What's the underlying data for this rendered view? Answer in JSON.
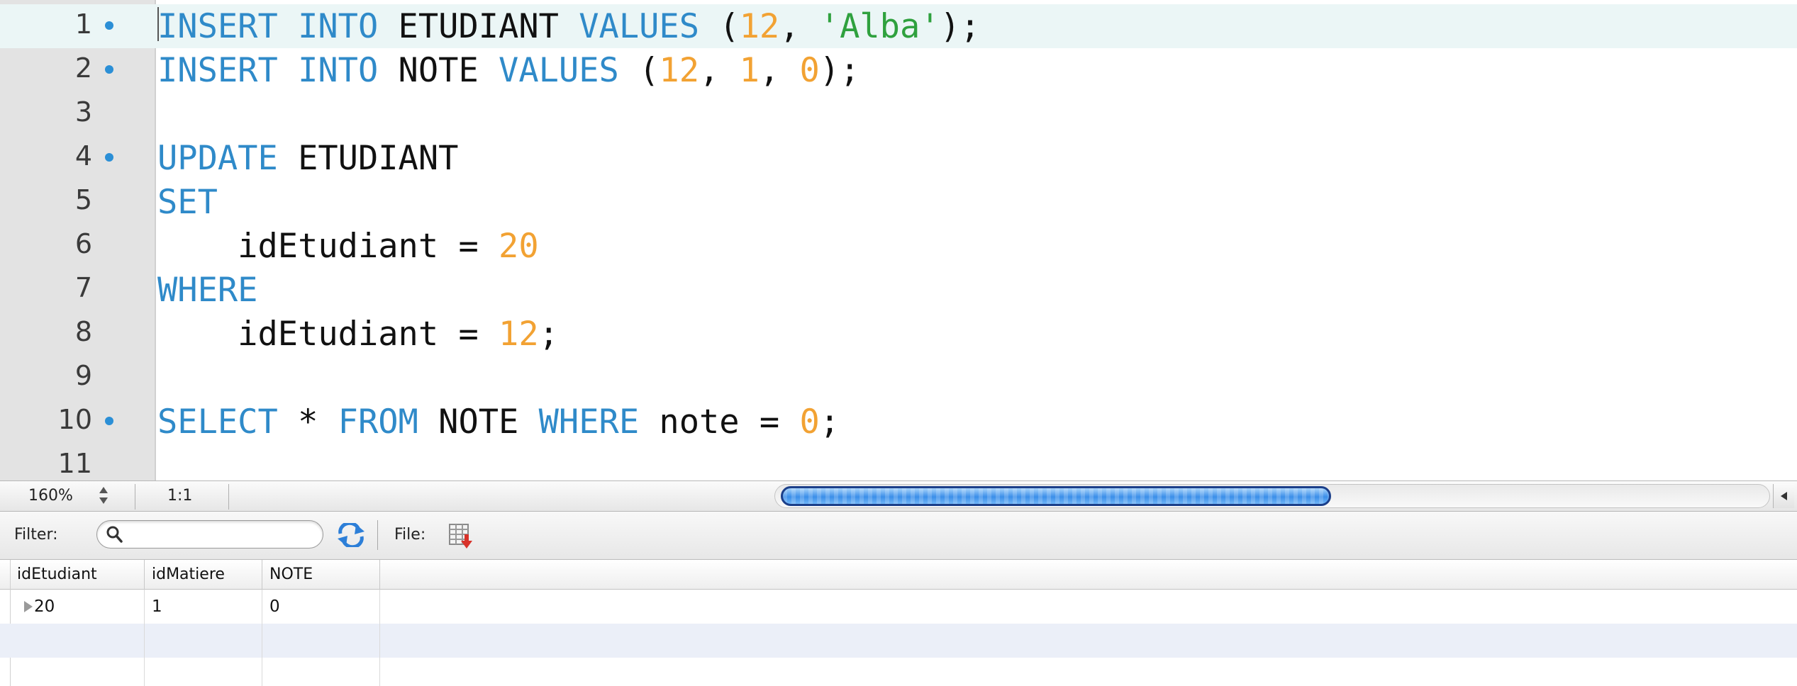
{
  "editor": {
    "lines": [
      {
        "number": "1",
        "has_bullet": true,
        "tokens": [
          [
            "kw",
            "INSERT"
          ],
          [
            "t",
            " "
          ],
          [
            "kw",
            "INTO"
          ],
          [
            "t",
            " ETUDIANT "
          ],
          [
            "kw",
            "VALUES"
          ],
          [
            "t",
            " ("
          ],
          [
            "num",
            "12"
          ],
          [
            "t",
            ", "
          ],
          [
            "str",
            "'Alba'"
          ],
          [
            "t",
            ");"
          ]
        ]
      },
      {
        "number": "2",
        "has_bullet": true,
        "tokens": [
          [
            "kw",
            "INSERT"
          ],
          [
            "t",
            " "
          ],
          [
            "kw",
            "INTO"
          ],
          [
            "t",
            " NOTE "
          ],
          [
            "kw",
            "VALUES"
          ],
          [
            "t",
            " ("
          ],
          [
            "num",
            "12"
          ],
          [
            "t",
            ", "
          ],
          [
            "num",
            "1"
          ],
          [
            "t",
            ", "
          ],
          [
            "num",
            "0"
          ],
          [
            "t",
            ");"
          ]
        ]
      },
      {
        "number": "3",
        "has_bullet": false,
        "tokens": []
      },
      {
        "number": "4",
        "has_bullet": true,
        "tokens": [
          [
            "kw",
            "UPDATE"
          ],
          [
            "t",
            " ETUDIANT"
          ]
        ]
      },
      {
        "number": "5",
        "has_bullet": false,
        "tokens": [
          [
            "kw",
            "SET"
          ]
        ]
      },
      {
        "number": "6",
        "has_bullet": false,
        "tokens": [
          [
            "t",
            "    idEtudiant = "
          ],
          [
            "num",
            "20"
          ]
        ]
      },
      {
        "number": "7",
        "has_bullet": false,
        "tokens": [
          [
            "kw",
            "WHERE"
          ]
        ]
      },
      {
        "number": "8",
        "has_bullet": false,
        "tokens": [
          [
            "t",
            "    idEtudiant = "
          ],
          [
            "num",
            "12"
          ],
          [
            "t",
            ";"
          ]
        ]
      },
      {
        "number": "9",
        "has_bullet": false,
        "tokens": []
      },
      {
        "number": "10",
        "has_bullet": true,
        "tokens": [
          [
            "kw",
            "SELECT"
          ],
          [
            "t",
            " * "
          ],
          [
            "kw",
            "FROM"
          ],
          [
            "t",
            " NOTE "
          ],
          [
            "kw",
            "WHERE"
          ],
          [
            "t",
            " note = "
          ],
          [
            "num",
            "0"
          ],
          [
            "t",
            ";"
          ]
        ]
      },
      {
        "number": "11",
        "has_bullet": false,
        "tokens": []
      }
    ],
    "current_line": 1,
    "colors": {
      "keyword": "#2f8ac9",
      "number": "#f2a233",
      "string": "#2fa13e",
      "current_line_bg": "#ebf6f6",
      "bullet": "#2b8fd6"
    }
  },
  "statusbar": {
    "zoom": "160%",
    "cursor_position": "1:1",
    "horizontal_scroll_fraction": 0.33
  },
  "filterbar": {
    "filter_label": "Filter:",
    "filter_value": "",
    "file_label": "File:"
  },
  "results": {
    "columns": [
      "idEtudiant",
      "idMatiere",
      "NOTE"
    ],
    "rows": [
      [
        "20",
        "1",
        "0"
      ]
    ]
  }
}
